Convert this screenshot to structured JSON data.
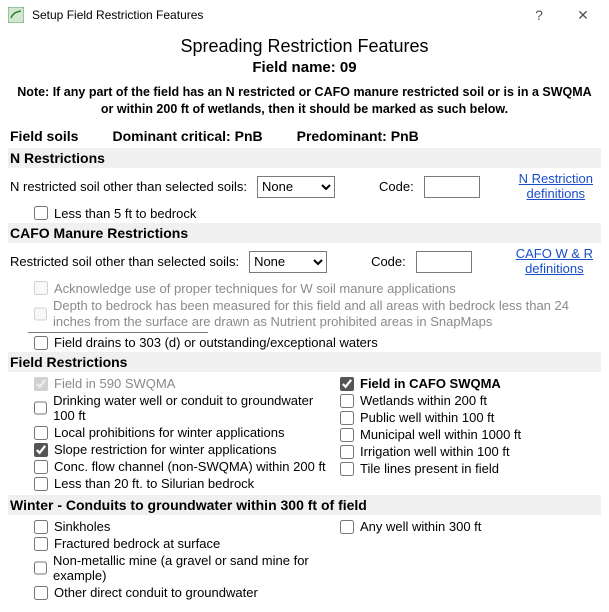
{
  "window": {
    "title": "Setup Field Restriction Features",
    "help": "?",
    "close": "✕"
  },
  "header": {
    "main_title": "Spreading Restriction Features",
    "field_label": "Field name: 09",
    "note": "Note: If any part of the field has an N restricted or CAFO manure restricted soil or is in a SWQMA or within 200 ft of wetlands, then it should be marked as such below."
  },
  "soils": {
    "field_soils": "Field soils",
    "dominant": "Dominant critical: PnB",
    "predominant": "Predominant: PnB"
  },
  "n_restrictions": {
    "header": "N Restrictions",
    "row_label": "N restricted soil other than selected soils:",
    "select_value": "None",
    "code_label": "Code:",
    "code_value": "",
    "link1": "N Restriction",
    "link2": "definitions",
    "less_5ft": "Less than 5 ft to bedrock"
  },
  "cafo": {
    "header": "CAFO Manure Restrictions",
    "row_label": "Restricted soil other than selected soils:",
    "select_value": "None",
    "code_label": "Code:",
    "code_value": "",
    "link1": "CAFO W & R",
    "link2": "definitions",
    "ack": "Acknowledge use of proper techniques for W soil manure applications",
    "depth": "Depth to bedrock has been measured for this field and all areas with bedrock less than 24 inches from the surface are drawn as Nutrient prohibited areas in SnapMaps",
    "drains": "Field drains to 303 (d) or outstanding/exceptional waters"
  },
  "field_restrictions": {
    "header": "Field Restrictions",
    "left": {
      "in590": "Field in 590 SWQMA",
      "drinking": "Drinking water well or conduit to groundwater 100 ft",
      "local_prohib": "Local prohibitions for winter applications",
      "slope": "Slope restriction for winter applications",
      "conc_flow": "Conc. flow channel (non-SWQMA) within 200 ft",
      "less20": "Less than 20 ft. to Silurian bedrock"
    },
    "right": {
      "cafo_swqma": "Field in CAFO SWQMA",
      "wetlands": "Wetlands within 200 ft",
      "public_well": "Public well within 100 ft",
      "municipal": "Municipal well within 1000 ft",
      "irrigation": "Irrigation well within 100 ft",
      "tile": "Tile lines present in field"
    }
  },
  "winter": {
    "header": "Winter - Conduits to groundwater within 300 ft of field",
    "left": {
      "sinkholes": "Sinkholes",
      "fractured": "Fractured bedrock at surface",
      "nonmetallic": "Non-metallic mine (a gravel or sand mine for example)",
      "other": "Other direct conduit to groundwater"
    },
    "right": {
      "any_well": "Any well within 300 ft"
    }
  }
}
